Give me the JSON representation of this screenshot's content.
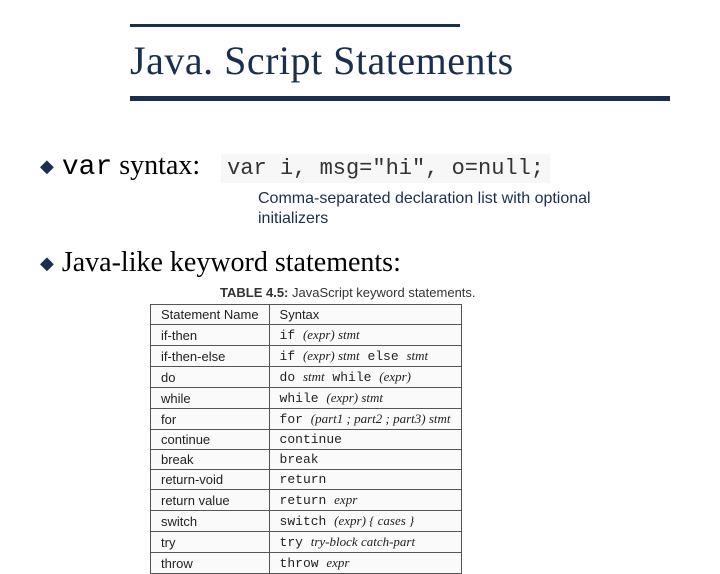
{
  "title": "Java. Script Statements",
  "bullet1": {
    "keyword": "var",
    "rest": " syntax:",
    "code": "var i, msg=\"hi\", o=null;"
  },
  "note": "Comma-separated declaration list with optional initializers",
  "bullet2": "Java-like keyword statements:",
  "table": {
    "caption_label": "TABLE 4.5:",
    "caption_text": " JavaScript keyword statements.",
    "header": [
      "Statement Name",
      "Syntax"
    ],
    "rows": [
      {
        "name": "if-then",
        "kw": "if ",
        "args": "(expr)  stmt"
      },
      {
        "name": "if-then-else",
        "kw": "if ",
        "args": "(expr)  stmt",
        "kw2": " else ",
        "args2": "stmt"
      },
      {
        "name": "do",
        "kw": "do ",
        "args": "stmt",
        "kw2": " while ",
        "args2": "(expr)"
      },
      {
        "name": "while",
        "kw": "while ",
        "args": "(expr)  stmt"
      },
      {
        "name": "for",
        "kw": "for ",
        "args": "(part1 ; part2 ; part3)  stmt"
      },
      {
        "name": "continue",
        "kw": "continue",
        "args": ""
      },
      {
        "name": "break",
        "kw": "break",
        "args": ""
      },
      {
        "name": "return-void",
        "kw": "return",
        "args": ""
      },
      {
        "name": "return value",
        "kw": "return ",
        "args": "expr"
      },
      {
        "name": "switch",
        "kw": "switch ",
        "args": "(expr)  { cases }"
      },
      {
        "name": "try",
        "kw": "try ",
        "args": "try-block catch-part"
      },
      {
        "name": "throw",
        "kw": "throw ",
        "args": "expr"
      }
    ]
  }
}
